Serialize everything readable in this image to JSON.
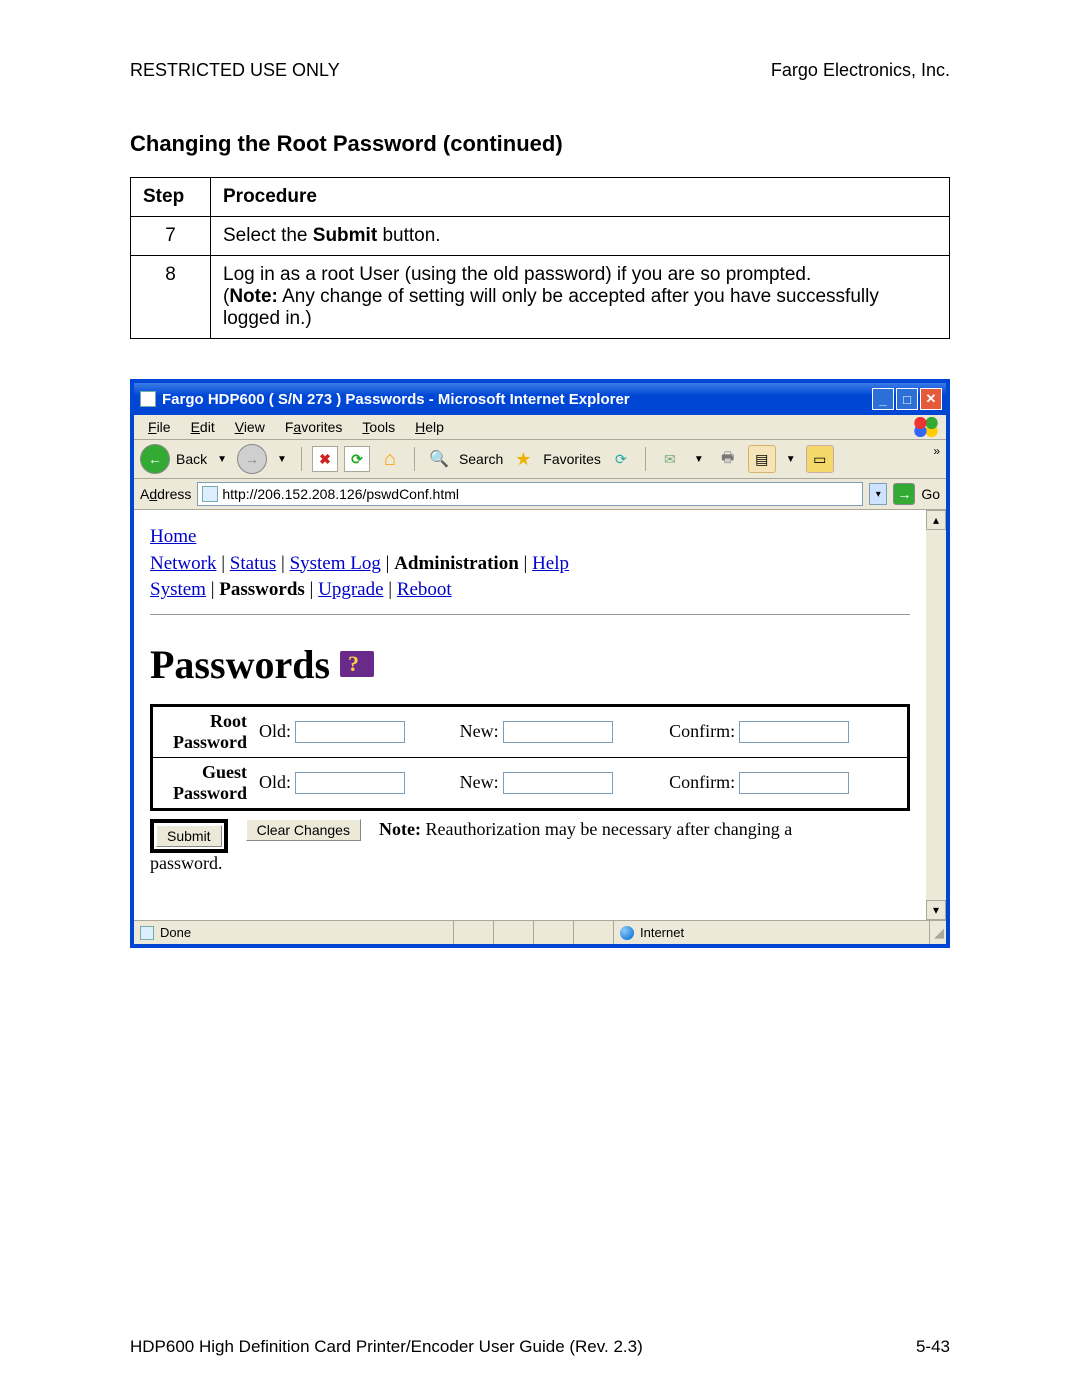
{
  "header": {
    "left": "RESTRICTED USE ONLY",
    "right": "Fargo Electronics, Inc."
  },
  "section_title": "Changing the Root Password (continued)",
  "table": {
    "cols": [
      "Step",
      "Procedure"
    ],
    "rows": [
      {
        "step": "7",
        "proc_pre": "Select the ",
        "proc_bold": "Submit",
        "proc_post": " button."
      },
      {
        "step": "8",
        "line1": "Log in as a root User (using the old password) if you are so prompted.",
        "note_label": "Note:",
        "note_rest": " Any change of setting will only be accepted after you have successfully logged in.)"
      }
    ]
  },
  "ie": {
    "title": "Fargo HDP600 ( S/N 273 ) Passwords - Microsoft Internet Explorer",
    "menus": [
      "File",
      "Edit",
      "View",
      "Favorites",
      "Tools",
      "Help"
    ],
    "back": "Back",
    "search": "Search",
    "favorites": "Favorites",
    "address_label": "Address",
    "address_value": "http://206.152.208.126/pswdConf.html",
    "go": "Go",
    "nav": {
      "home": "Home",
      "row2": [
        "Network",
        "Status",
        "System Log",
        "Administration",
        "Help"
      ],
      "row2_current_index": 3,
      "row3": [
        "System",
        "Passwords",
        "Upgrade",
        "Reboot"
      ],
      "row3_current_index": 1
    },
    "heading": "Passwords",
    "pw": {
      "rows": [
        {
          "label": "Root Password",
          "old": "Old:",
          "new": "New:",
          "confirm": "Confirm:"
        },
        {
          "label": "Guest Password",
          "old": "Old:",
          "new": "New:",
          "confirm": "Confirm:"
        }
      ]
    },
    "submit": "Submit",
    "clear": "Clear Changes",
    "note_label": "Note:",
    "note_text": " Reauthorization may be necessary after changing a",
    "note_cont": "password.",
    "status_done": "Done",
    "status_zone": "Internet"
  },
  "footer": {
    "left": "HDP600 High Definition Card Printer/Encoder User Guide (Rev. 2.3)",
    "right": "5-43"
  }
}
